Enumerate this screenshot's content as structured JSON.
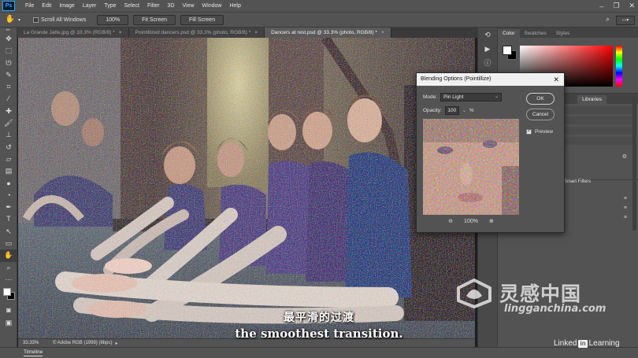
{
  "app": {
    "logo": "Ps"
  },
  "menubar": {
    "items": [
      "File",
      "Edit",
      "Image",
      "Layer",
      "Type",
      "Select",
      "Filter",
      "3D",
      "View",
      "Window",
      "Help"
    ],
    "window_controls": [
      "minimize-icon",
      "restore-icon",
      "close-icon"
    ]
  },
  "options_bar": {
    "tool_icon": "hand-icon",
    "scroll_all_label": "Scroll All Windows",
    "scroll_all_checked": false,
    "zoom_button": "100%",
    "fit_screen_button": "Fit Screen",
    "fill_screen_button": "Fill Screen"
  },
  "tabs": [
    {
      "label": "La Grande Jatte.jpg @ 33.3% (RGB/8) *",
      "active": false
    },
    {
      "label": "Pointillized dancers.psd @ 33.3% (photo, RGB/8) *",
      "active": false
    },
    {
      "label": "Dancers at rest.psd @ 33.3% (photo, RGB/8) *",
      "active": true
    }
  ],
  "toolbar": {
    "tools": [
      "move-icon",
      "marquee-icon",
      "lasso-icon",
      "quick-select-icon",
      "crop-icon",
      "eyedropper-icon",
      "healing-icon",
      "brush-icon",
      "stamp-icon",
      "history-brush-icon",
      "eraser-icon",
      "gradient-icon",
      "blur-icon",
      "dodge-icon",
      "pen-icon",
      "type-icon",
      "path-select-icon",
      "rectangle-icon",
      "hand-icon",
      "zoom-icon"
    ],
    "selected_tool": "hand-icon"
  },
  "status": {
    "zoom": "33.33%",
    "info": "© Adobe RGB (1998) (8bpc)"
  },
  "timeline": {
    "label": "Timeline"
  },
  "panels": {
    "color_tabs": [
      "Color",
      "Swatches",
      "Styles"
    ],
    "active_color_tab": "Color",
    "library_tabs": [
      "Libraries"
    ],
    "smart_filters_label": "Smart Filters"
  },
  "dialog": {
    "title": "Blending Options (Pointillize)",
    "mode_label": "Mode:",
    "mode_value": "Pin Light",
    "opacity_label": "Opacity:",
    "opacity_value": "100",
    "opacity_unit": "%",
    "ok_label": "OK",
    "cancel_label": "Cancel",
    "preview_label": "Preview",
    "preview_checked": true,
    "zoom_value": "100%"
  },
  "subtitles": {
    "zh": "最平滑的过渡",
    "en": "the smoothest transition."
  },
  "watermark": {
    "title": "灵感中国",
    "url": "lingganchina.com"
  },
  "branding": {
    "linkedin_word": "Linked",
    "linkedin_in": "in",
    "learning_word": "Learning"
  },
  "colors": {
    "accent": "#31a8ff",
    "ui_gray": "#535353",
    "panel_dark": "#434343"
  }
}
